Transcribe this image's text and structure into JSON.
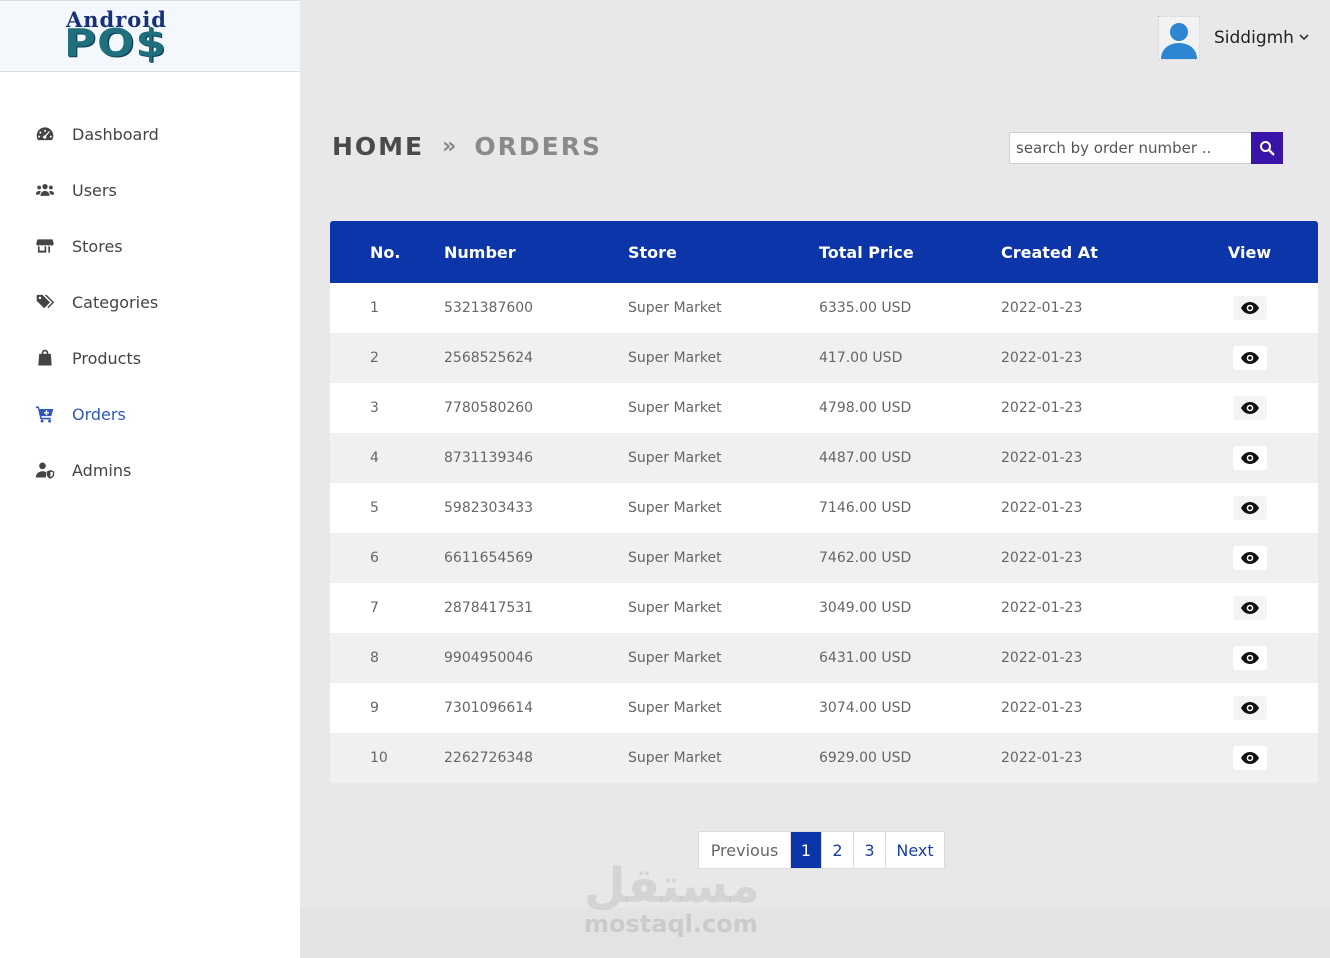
{
  "brand": {
    "line1": "Android",
    "line2": "PO$"
  },
  "sidebar": {
    "items": [
      {
        "label": "Dashboard",
        "icon": "dashboard-icon",
        "active": false
      },
      {
        "label": "Users",
        "icon": "users-icon",
        "active": false
      },
      {
        "label": "Stores",
        "icon": "store-icon",
        "active": false
      },
      {
        "label": "Categories",
        "icon": "tags-icon",
        "active": false
      },
      {
        "label": "Products",
        "icon": "shopping-bag-icon",
        "active": false
      },
      {
        "label": "Orders",
        "icon": "cart-icon",
        "active": true
      },
      {
        "label": "Admins",
        "icon": "user-shield-icon",
        "active": false
      }
    ]
  },
  "header": {
    "username": "Siddigmh",
    "caret": "⌄"
  },
  "breadcrumb": {
    "home": "HOME",
    "separator": "»",
    "current": "ORDERS"
  },
  "search": {
    "placeholder": "search by order number .."
  },
  "table": {
    "columns": [
      "No.",
      "Number",
      "Store",
      "Total Price",
      "Created At",
      "View"
    ],
    "rows": [
      {
        "no": "1",
        "number": "5321387600",
        "store": "Super Market",
        "total": "6335.00 USD",
        "created": "2022-01-23"
      },
      {
        "no": "2",
        "number": "2568525624",
        "store": "Super Market",
        "total": "417.00 USD",
        "created": "2022-01-23"
      },
      {
        "no": "3",
        "number": "7780580260",
        "store": "Super Market",
        "total": "4798.00 USD",
        "created": "2022-01-23"
      },
      {
        "no": "4",
        "number": "8731139346",
        "store": "Super Market",
        "total": "4487.00 USD",
        "created": "2022-01-23"
      },
      {
        "no": "5",
        "number": "5982303433",
        "store": "Super Market",
        "total": "7146.00 USD",
        "created": "2022-01-23"
      },
      {
        "no": "6",
        "number": "6611654569",
        "store": "Super Market",
        "total": "7462.00 USD",
        "created": "2022-01-23"
      },
      {
        "no": "7",
        "number": "2878417531",
        "store": "Super Market",
        "total": "3049.00 USD",
        "created": "2022-01-23"
      },
      {
        "no": "8",
        "number": "9904950046",
        "store": "Super Market",
        "total": "6431.00 USD",
        "created": "2022-01-23"
      },
      {
        "no": "9",
        "number": "7301096614",
        "store": "Super Market",
        "total": "3074.00 USD",
        "created": "2022-01-23"
      },
      {
        "no": "10",
        "number": "2262726348",
        "store": "Super Market",
        "total": "6929.00 USD",
        "created": "2022-01-23"
      }
    ]
  },
  "pagination": {
    "previous": "Previous",
    "pages": [
      "1",
      "2",
      "3"
    ],
    "current": "1",
    "next": "Next"
  },
  "watermark": {
    "arabic": "مستقل",
    "latin": "mostaql.com"
  },
  "colors": {
    "primary": "#0b35a8",
    "search_button": "#3a14a8",
    "active_nav": "#3157b8"
  }
}
